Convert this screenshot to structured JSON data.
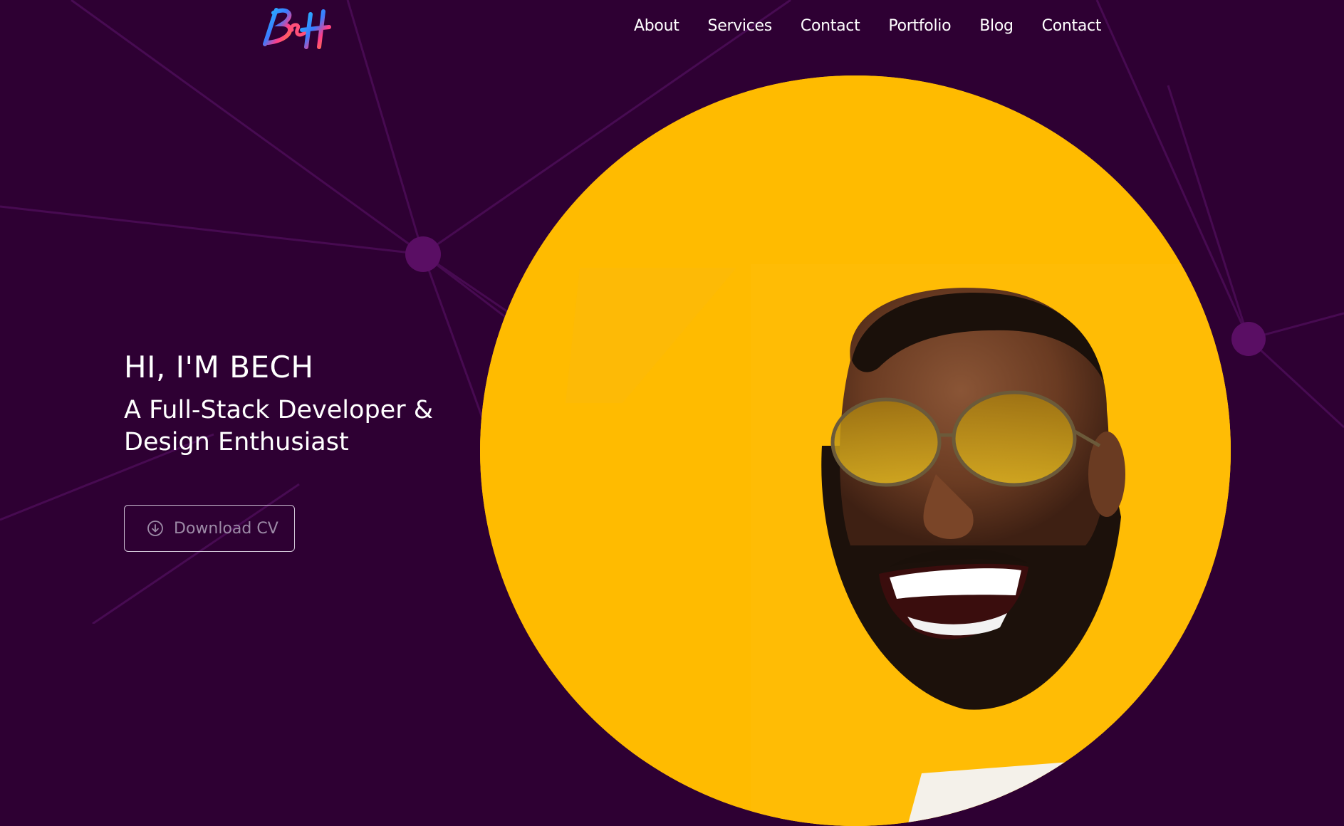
{
  "brand": {
    "logo_text": "BcH",
    "colors": {
      "background": "#2e0033",
      "accent_yellow": "#ffbb00",
      "network_line": "#4c0f58",
      "network_node": "#5c0e66",
      "text": "#ffffff",
      "button_text": "#9c8aa6"
    }
  },
  "nav": {
    "items": [
      {
        "label": "About"
      },
      {
        "label": "Services"
      },
      {
        "label": "Contact"
      },
      {
        "label": "Portfolio"
      },
      {
        "label": "Blog"
      },
      {
        "label": "Contact"
      }
    ]
  },
  "hero": {
    "greeting": "HI, I'M BECH",
    "tagline": "A Full-Stack Developer & Design Enthusiast",
    "cv_button": {
      "label": "Download CV",
      "icon": "download-circle-icon"
    },
    "photo": {
      "icon": "portrait-photo"
    }
  }
}
